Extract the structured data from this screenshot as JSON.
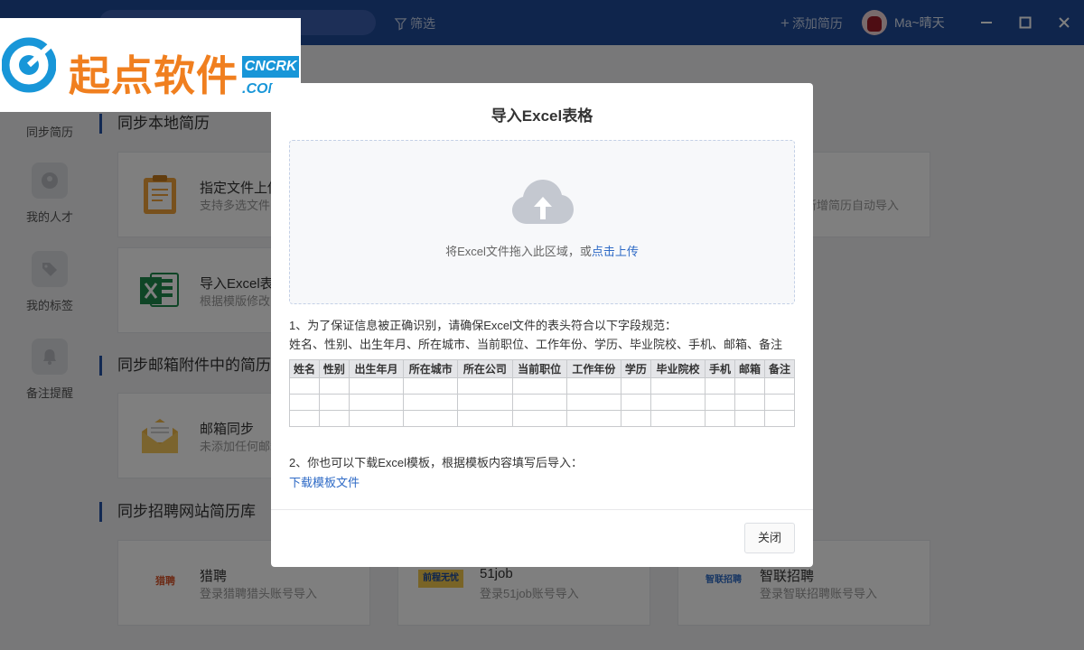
{
  "titlebar": {
    "filter_label": "筛选",
    "add_resume_label": "添加简历",
    "user_name": "Ma~晴天"
  },
  "leftnav": {
    "items": [
      {
        "label": "同步简历",
        "icon": "sync-icon"
      },
      {
        "label": "我的人才",
        "icon": "talent-icon"
      },
      {
        "label": "我的标签",
        "icon": "tag-icon"
      },
      {
        "label": "备注提醒",
        "icon": "bell-icon"
      }
    ]
  },
  "main": {
    "sections": [
      {
        "title": "同步本地简历"
      },
      {
        "title": "同步邮箱附件中的简历"
      },
      {
        "title": "同步招聘网站简历库"
      }
    ],
    "local_cards": [
      {
        "title": "指定文件上传",
        "subtitle": "支持多选文件",
        "icon": "clipboard-icon"
      },
      {
        "title": "导入Excel表格",
        "subtitle": "根据模版修改",
        "icon": "excel-icon"
      }
    ],
    "right_card": {
      "subtitle": "新增简历自动导入"
    },
    "email_card": {
      "title": "邮箱同步",
      "subtitle": "未添加任何邮箱",
      "icon": "mail-icon"
    },
    "site_cards": [
      {
        "title": "猎聘",
        "subtitle": "登录猎聘猎头账号导入",
        "logo": "猎聘"
      },
      {
        "title": "51job",
        "subtitle": "登录51job账号导入",
        "logo": "前程无忧"
      },
      {
        "title": "智联招聘",
        "subtitle": "登录智联招聘账号导入",
        "logo": "智联招聘"
      }
    ]
  },
  "watermark": {
    "text": "起点软件",
    "badge": "CNCRK",
    "domain": ".COM"
  },
  "modal": {
    "title": "导入Excel表格",
    "drop_text": "将Excel文件拖入此区域，或",
    "drop_link": "点击上传",
    "note1": "1、为了保证信息被正确识别，请确保Excel文件的表头符合以下字段规范：",
    "fields": "姓名、性别、出生年月、所在城市、当前职位、工作年份、学历、毕业院校、手机、邮箱、备注",
    "table_headers": [
      "姓名",
      "性别",
      "出生年月",
      "所在城市",
      "所在公司",
      "当前职位",
      "工作年份",
      "学历",
      "毕业院校",
      "手机",
      "邮箱",
      "备注"
    ],
    "note2": "2、你也可以下载Excel模板，根据模板内容填写后导入：",
    "download_link": "下载模板文件",
    "close_label": "关闭"
  },
  "colors": {
    "titlebar": "#1e4a99",
    "link": "#2e6ac6",
    "accent": "#2453a6"
  }
}
